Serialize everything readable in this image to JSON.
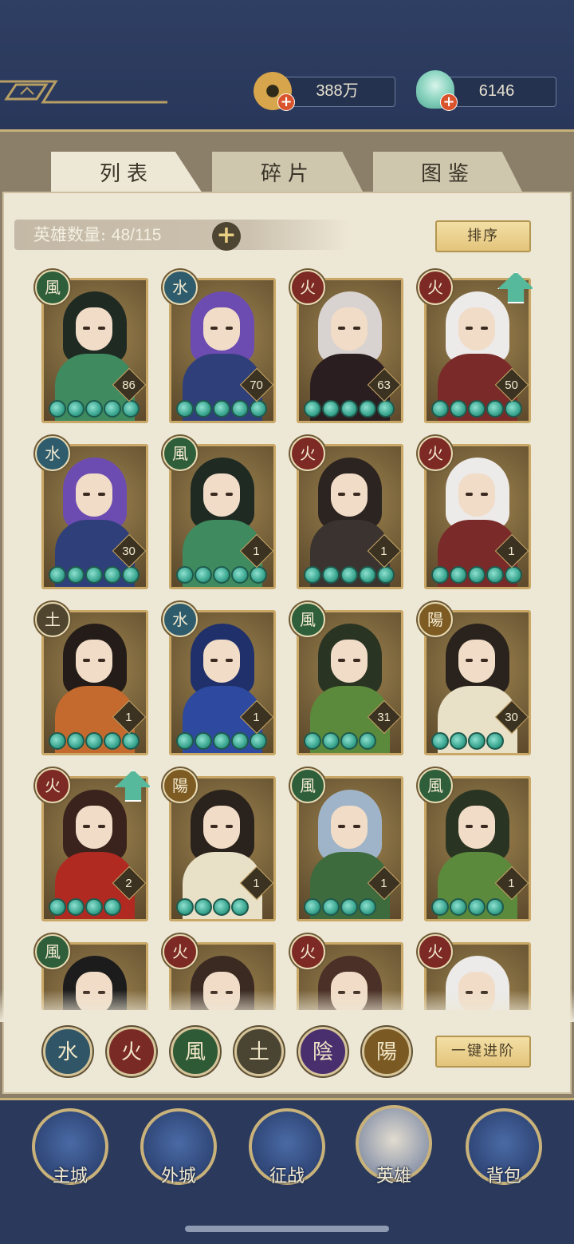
{
  "currencies": [
    {
      "name": "coin",
      "value": "388万",
      "icon": "copper-coin-icon"
    },
    {
      "name": "jade",
      "value": "6146",
      "icon": "jade-shell-icon"
    }
  ],
  "tabs": [
    {
      "label": "列表",
      "active": true
    },
    {
      "label": "碎片",
      "active": false
    },
    {
      "label": "图鉴",
      "active": false
    }
  ],
  "hero_count": {
    "label": "英雄数量:",
    "value": "48/115"
  },
  "sort_label": "排序",
  "advance_all_label": "一键进阶",
  "heroes": [
    {
      "element": "風",
      "level": "86",
      "stars": 5,
      "upgrade": false,
      "palette": "wind-green"
    },
    {
      "element": "水",
      "level": "70",
      "stars": 5,
      "upgrade": false,
      "palette": "water-purple"
    },
    {
      "element": "火",
      "level": "63",
      "stars": 5,
      "upgrade": false,
      "palette": "fire-dark"
    },
    {
      "element": "火",
      "level": "50",
      "stars": 5,
      "upgrade": true,
      "palette": "fire-white"
    },
    {
      "element": "水",
      "level": "30",
      "stars": 5,
      "upgrade": false,
      "palette": "water-purple"
    },
    {
      "element": "風",
      "level": "1",
      "stars": 5,
      "upgrade": false,
      "palette": "wind-green"
    },
    {
      "element": "火",
      "level": "1",
      "stars": 5,
      "upgrade": false,
      "palette": "fire-hat"
    },
    {
      "element": "火",
      "level": "1",
      "stars": 5,
      "upgrade": false,
      "palette": "fire-white"
    },
    {
      "element": "土",
      "level": "1",
      "stars": 5,
      "upgrade": false,
      "palette": "earth-orange"
    },
    {
      "element": "水",
      "level": "1",
      "stars": 5,
      "upgrade": false,
      "palette": "water-blue"
    },
    {
      "element": "風",
      "level": "31",
      "stars": 4,
      "upgrade": false,
      "palette": "wind-moth"
    },
    {
      "element": "陽",
      "level": "30",
      "stars": 4,
      "upgrade": false,
      "palette": "yang-cream"
    },
    {
      "element": "火",
      "level": "2",
      "stars": 4,
      "upgrade": true,
      "palette": "fire-red"
    },
    {
      "element": "陽",
      "level": "1",
      "stars": 4,
      "upgrade": false,
      "palette": "yang-cream"
    },
    {
      "element": "風",
      "level": "1",
      "stars": 4,
      "upgrade": false,
      "palette": "wind-silver"
    },
    {
      "element": "風",
      "level": "1",
      "stars": 4,
      "upgrade": false,
      "palette": "wind-moth"
    },
    {
      "element": "風",
      "level": "",
      "stars": 0,
      "upgrade": false,
      "palette": "wind-dark"
    },
    {
      "element": "火",
      "level": "",
      "stars": 0,
      "upgrade": false,
      "palette": "fire-mask"
    },
    {
      "element": "火",
      "level": "",
      "stars": 0,
      "upgrade": false,
      "palette": "fire-brown"
    },
    {
      "element": "火",
      "level": "",
      "stars": 0,
      "upgrade": false,
      "palette": "fire-white"
    }
  ],
  "element_filters": [
    {
      "label": "水",
      "color": "#2f5566"
    },
    {
      "label": "火",
      "color": "#7a2a25"
    },
    {
      "label": "風",
      "color": "#2f5a36"
    },
    {
      "label": "土",
      "color": "#4a4433"
    },
    {
      "label": "陰",
      "color": "#4a2f6e"
    },
    {
      "label": "陽",
      "color": "#7a5a22"
    }
  ],
  "element_colors": {
    "水": "#2e5c6d",
    "火": "#7d2a24",
    "風": "#2f5e3a",
    "土": "#50462f",
    "陰": "#4d3173",
    "陽": "#7d5b23"
  },
  "palettes": {
    "wind-green": {
      "hair": "#1f2a23",
      "body": "#3f8a5f"
    },
    "water-purple": {
      "hair": "#6c4cb1",
      "body": "#2f3f7a"
    },
    "fire-dark": {
      "hair": "#d8d2d0",
      "body": "#2a1e20"
    },
    "fire-white": {
      "hair": "#ecebea",
      "body": "#7a2a28"
    },
    "fire-hat": {
      "hair": "#2c2420",
      "body": "#3b3330"
    },
    "earth-orange": {
      "hair": "#241c18",
      "body": "#c46a2e"
    },
    "water-blue": {
      "hair": "#20306b",
      "body": "#2d4aa0"
    },
    "wind-moth": {
      "hair": "#2a3422",
      "body": "#5c8a3c"
    },
    "yang-cream": {
      "hair": "#2a221c",
      "body": "#e9e0c8"
    },
    "fire-red": {
      "hair": "#3a231c",
      "body": "#b02a22"
    },
    "wind-silver": {
      "hair": "#9fb4c8",
      "body": "#3d6b3d"
    },
    "wind-dark": {
      "hair": "#1c1c1c",
      "body": "#3e5a3a"
    },
    "fire-mask": {
      "hair": "#3a2a22",
      "body": "#7a2020"
    },
    "fire-brown": {
      "hair": "#4a3026",
      "body": "#6a2a22"
    }
  },
  "nav": [
    {
      "label": "主城",
      "icon": "palace-icon",
      "active": false
    },
    {
      "label": "外城",
      "icon": "city-gate-icon",
      "active": false
    },
    {
      "label": "征战",
      "icon": "war-horn-icon",
      "active": false
    },
    {
      "label": "英雄",
      "icon": "hero-portrait-icon",
      "active": true
    },
    {
      "label": "背包",
      "icon": "bag-icon",
      "active": false
    }
  ]
}
